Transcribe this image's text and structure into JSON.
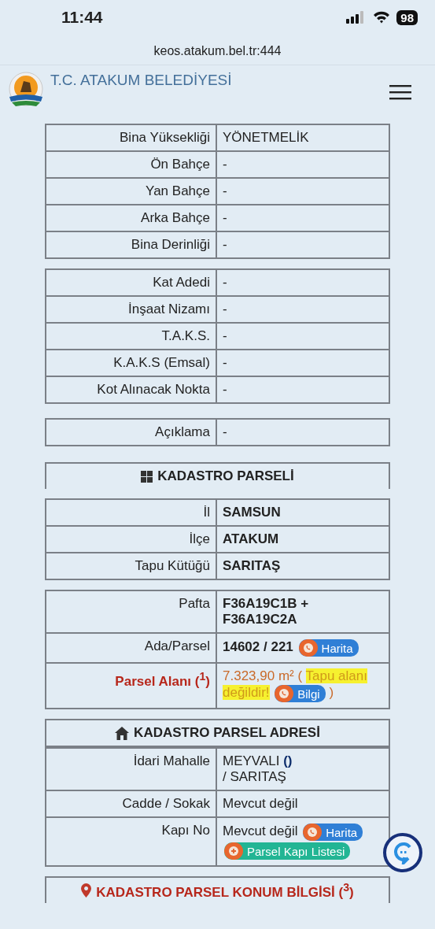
{
  "status_bar": {
    "time": "11:44",
    "battery": "98"
  },
  "browser": {
    "url": "keos.atakum.bel.tr:444"
  },
  "header": {
    "title": "T.C. ATAKUM BELEDİYESİ"
  },
  "sections": [
    {
      "rows": [
        {
          "label": "Bina Yüksekliği",
          "value": [
            {
              "kind": "text",
              "text": "YÖNETMELİK"
            }
          ]
        },
        {
          "label": "Ön Bahçe",
          "value": [
            {
              "kind": "text",
              "text": "-"
            }
          ]
        },
        {
          "label": "Yan Bahçe",
          "value": [
            {
              "kind": "text",
              "text": "-"
            }
          ]
        },
        {
          "label": "Arka Bahçe",
          "value": [
            {
              "kind": "text",
              "text": "-"
            }
          ]
        },
        {
          "label": "Bina Derinliği",
          "value": [
            {
              "kind": "text",
              "text": "-"
            }
          ]
        }
      ]
    },
    {
      "rows": [
        {
          "label": "Kat Adedi",
          "value": [
            {
              "kind": "text",
              "text": "-"
            }
          ]
        },
        {
          "label": "İnşaat Nizamı",
          "value": [
            {
              "kind": "text",
              "text": "-"
            }
          ]
        },
        {
          "label": "T.A.K.S.",
          "value": [
            {
              "kind": "text",
              "text": "-"
            }
          ]
        },
        {
          "label": "K.A.K.S (Emsal)",
          "value": [
            {
              "kind": "text",
              "text": "-"
            }
          ]
        },
        {
          "label": "Kot Alınacak Nokta",
          "value": [
            {
              "kind": "text",
              "text": "-"
            }
          ]
        }
      ]
    },
    {
      "rows": [
        {
          "label": "Açıklama",
          "value": [
            {
              "kind": "text",
              "text": "-"
            }
          ]
        }
      ]
    },
    {
      "heading": {
        "text": "KADASTRO PARSELİ",
        "kind": "parcel"
      }
    },
    {
      "rows": [
        {
          "label": "İl",
          "value": [
            {
              "kind": "bold",
              "text": "SAMSUN"
            }
          ]
        },
        {
          "label": "İlçe",
          "value": [
            {
              "kind": "bold",
              "text": "ATAKUM"
            }
          ]
        },
        {
          "label": "Tapu Kütüğü",
          "value": [
            {
              "kind": "bold",
              "text": "SARITAŞ"
            }
          ]
        }
      ]
    },
    {
      "rows": [
        {
          "label": "Pafta",
          "value": [
            {
              "kind": "bold",
              "text": "F36A19C1B + F36A19C2A"
            }
          ]
        },
        {
          "label": "Ada/Parsel",
          "value": [
            {
              "kind": "bold",
              "text": "14602 / 221"
            },
            {
              "kind": "button",
              "text": "Harita",
              "color": "#2f7fd6"
            }
          ]
        },
        {
          "label": "Parsel Alanı ($^{1}$)",
          "alert": true,
          "value": [
            {
              "kind": "warn",
              "text": "7.323,90 m² ("
            },
            {
              "kind": "highlight",
              "text": "Tapu alanı değildir!"
            },
            {
              "kind": "button",
              "text": "Bilgi",
              "color": "#2f7fd6"
            },
            {
              "kind": "warn",
              "text": ")"
            }
          ]
        }
      ]
    },
    {
      "heading": {
        "text": "KADASTRO PARSEL ADRESİ",
        "kind": "address"
      },
      "rows": [
        {
          "label": "İdari Mahalle",
          "value": [
            {
              "kind": "text",
              "text": "MEYVALI"
            },
            {
              "kind": "link",
              "text": "()"
            },
            {
              "kind": "text",
              "text": "/ SARITAŞ",
              "line_break": true
            }
          ]
        },
        {
          "label": "Cadde / Sokak",
          "value": [
            {
              "kind": "text",
              "text": "Mevcut değil"
            }
          ]
        },
        {
          "label": "Kapı No",
          "value": [
            {
              "kind": "text",
              "text": "Mevcut değil"
            },
            {
              "kind": "button",
              "text": "Harita",
              "color": "#2f7fd6"
            },
            {
              "kind": "add_button",
              "text": "Parsel Kapı Listesi",
              "color": "#22b594"
            }
          ]
        }
      ]
    },
    {
      "heading": {
        "text": "KADASTRO PARSEL KONUM BİLGİSİ ($^{3}$)",
        "kind": "location",
        "alert": true
      }
    }
  ]
}
